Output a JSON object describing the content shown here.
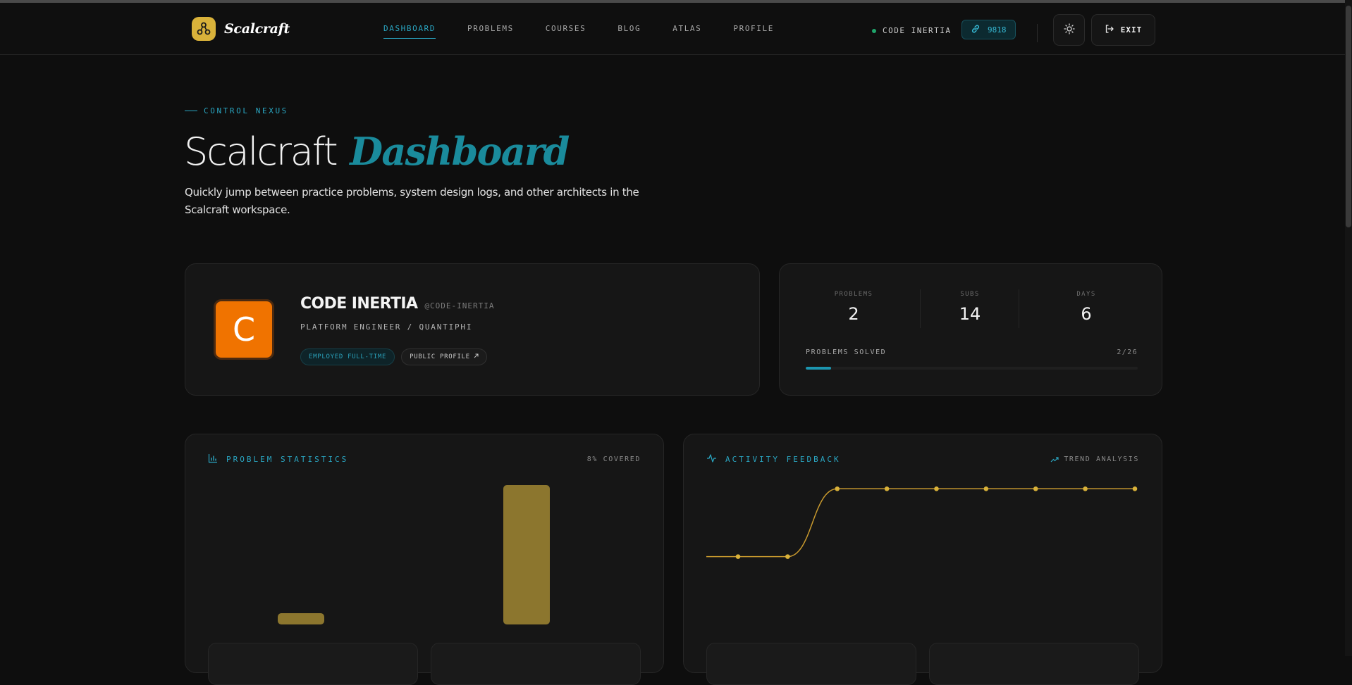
{
  "brand": {
    "name": "Scalcraft"
  },
  "nav": [
    {
      "label": "DASHBOARD",
      "active": true
    },
    {
      "label": "PROBLEMS"
    },
    {
      "label": "COURSES"
    },
    {
      "label": "BLOG"
    },
    {
      "label": "ATLAS"
    },
    {
      "label": "PROFILE"
    }
  ],
  "header": {
    "user_name": "CODE INERTIA",
    "points": "9818",
    "exit_label": "EXIT"
  },
  "hero": {
    "eyebrow": "CONTROL NEXUS",
    "title_plain": "Scalcraft",
    "title_accent": "Dashboard",
    "subtitle": "Quickly jump between practice problems, system design logs, and other architects in the Scalcraft workspace."
  },
  "profile": {
    "avatar_initial": "C",
    "name": "CODE INERTIA",
    "handle": "@CODE-INERTIA",
    "role": "PLATFORM ENGINEER / QUANTIPHI",
    "badge_employed": "EMPLOYED FULL-TIME",
    "badge_public": "PUBLIC PROFILE"
  },
  "stats": {
    "problems_label": "PROBLEMS",
    "problems_value": "2",
    "subs_label": "SUBS",
    "subs_value": "14",
    "days_label": "DAYS",
    "days_value": "6",
    "progress_label": "PROBLEMS SOLVED",
    "progress_count": "2/26",
    "solved": 2,
    "total": 26
  },
  "problem_statistics": {
    "title": "PROBLEM STATISTICS",
    "meta": "8% COVERED"
  },
  "activity_feedback": {
    "title": "ACTIVITY FEEDBACK",
    "meta": "TREND ANALYSIS"
  },
  "colors": {
    "accent": "#2aa6c2",
    "gold": "#d9b23a",
    "bar": "#8c762e",
    "line": "#c99a2e",
    "avatar": "#f07300"
  },
  "chart_data": [
    {
      "type": "bar",
      "title": "PROBLEM STATISTICS",
      "categories": [
        "",
        ""
      ],
      "values": [
        1,
        14
      ],
      "ylim": [
        0,
        14
      ],
      "grid": false
    },
    {
      "type": "line",
      "title": "ACTIVITY FEEDBACK",
      "x": [
        1,
        2,
        3,
        4,
        5,
        6,
        7,
        8,
        9
      ],
      "y": [
        1,
        1,
        2,
        2,
        2,
        2,
        2,
        2,
        2
      ],
      "ylim": [
        0,
        2.2
      ],
      "grid": false
    }
  ]
}
